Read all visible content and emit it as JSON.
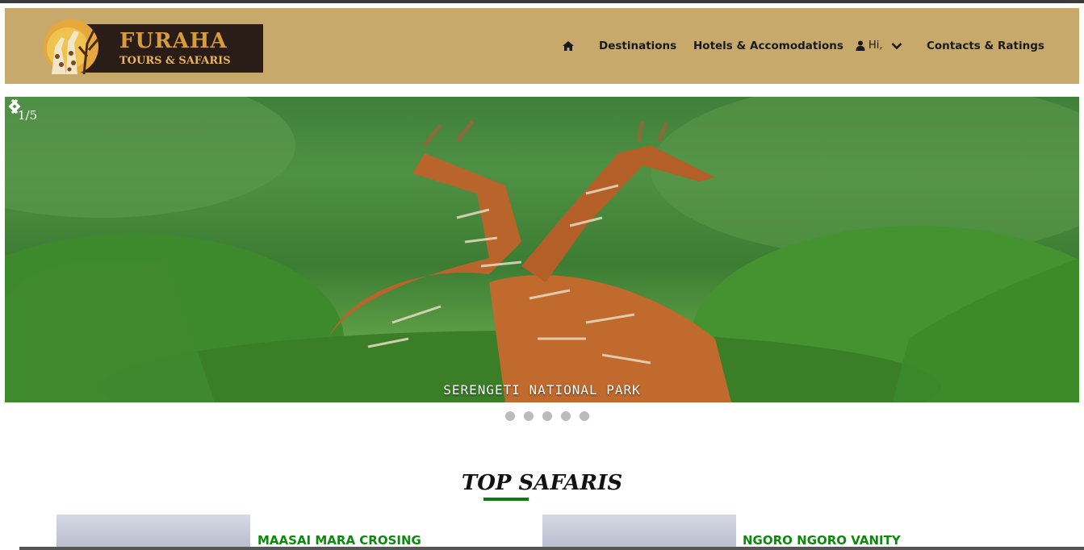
{
  "logo": {
    "title": "FURAHA",
    "subtitle": "TOURS & SAFARIS"
  },
  "nav": {
    "home_icon": "home-icon",
    "items": [
      "Destinations",
      "Hotels & Accomodations"
    ],
    "user_greeting": "Hi,",
    "user_icon": "user-icon",
    "contacts": "Contacts & Ratings"
  },
  "slider": {
    "counter": "1/5",
    "caption": "SERENGETI NATIONAL PARK",
    "total_slides": 5,
    "active_slide": 1
  },
  "section": {
    "title": "TOP SAFARIS"
  },
  "cards": [
    {
      "title": "MAASAI MARA CROSING"
    },
    {
      "title": "NGORO NGORO VANITY"
    }
  ],
  "colors": {
    "navbar": "#c6a96b",
    "accent_green": "#0d8a0d"
  }
}
